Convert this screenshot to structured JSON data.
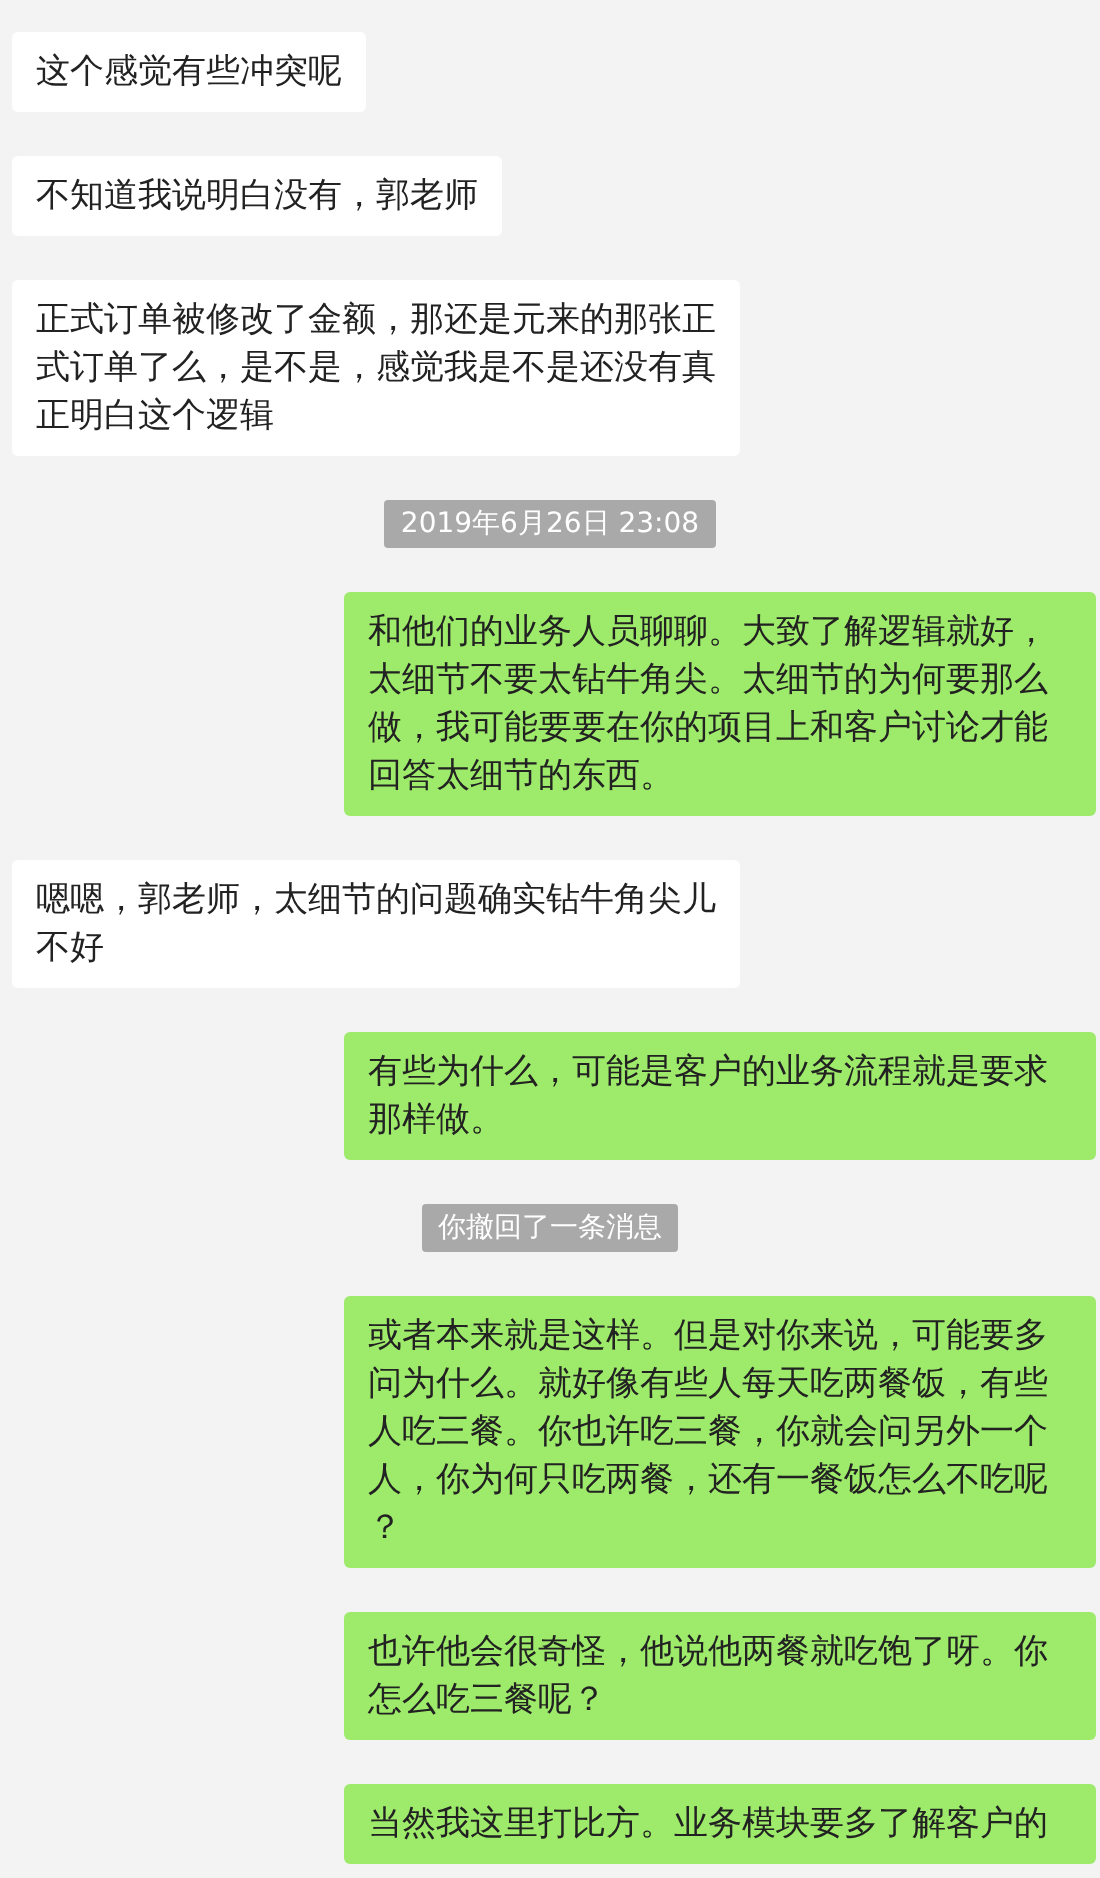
{
  "messages": [
    {
      "kind": "received",
      "lines": [
        "这个感觉有些冲突呢"
      ]
    },
    {
      "kind": "received",
      "lines": [
        "不知道我说明白没有，郭老师"
      ]
    },
    {
      "kind": "received",
      "lines": [
        "正式订单被修改了金额，那还是元来的那张正",
        "式订单了么，是不是，感觉我是不是还没有真",
        "正明白这个逻辑"
      ]
    },
    {
      "kind": "system",
      "lines": [
        "2019年6月26日 23:08"
      ]
    },
    {
      "kind": "sent",
      "lines": [
        "和他们的业务人员聊聊。大致了解逻辑就好，",
        "太细节不要太钻牛角尖。太细节的为何要那么",
        "做，我可能要要在你的项目上和客户讨论才能",
        "回答太细节的东西。"
      ]
    },
    {
      "kind": "received",
      "lines": [
        "嗯嗯，郭老师，太细节的问题确实钻牛角尖儿",
        "不好"
      ]
    },
    {
      "kind": "sent",
      "lines": [
        "有些为什么，可能是客户的业务流程就是要求",
        "那样做。"
      ]
    },
    {
      "kind": "system",
      "lines": [
        "你撤回了一条消息"
      ]
    },
    {
      "kind": "sent",
      "lines": [
        "或者本来就是这样。但是对你来说，可能要多",
        "问为什么。就好像有些人每天吃两餐饭，有些",
        "人吃三餐。你也许吃三餐，你就会问另外一个",
        "人，你为何只吃两餐，还有一餐饭怎么不吃呢",
        "？"
      ]
    },
    {
      "kind": "sent",
      "lines": [
        "也许他会很奇怪，他说他两餐就吃饱了呀。你",
        "怎么吃三餐呢？"
      ]
    },
    {
      "kind": "sent",
      "lines": [
        "当然我这里打比方。业务模块要多了解客户的"
      ]
    }
  ]
}
